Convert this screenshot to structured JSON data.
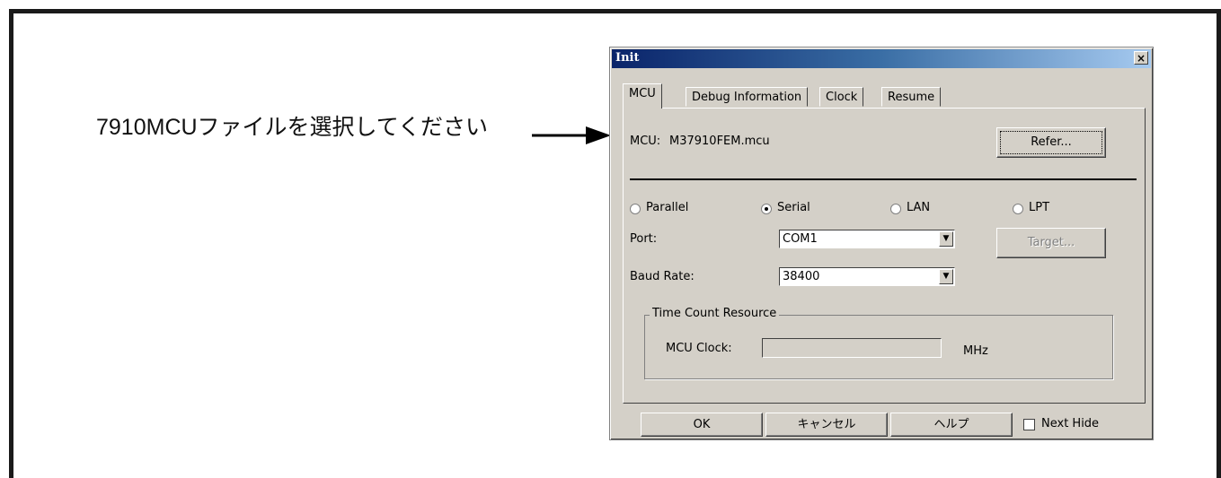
{
  "annotation": {
    "text": "7910MCUファイルを選択してください"
  },
  "dialog": {
    "title": "Init",
    "close_glyph": "×",
    "tabs": [
      {
        "label": "MCU",
        "active": true
      },
      {
        "label": "Debug Information",
        "active": false
      },
      {
        "label": "Clock",
        "active": false
      },
      {
        "label": "Resume",
        "active": false
      }
    ],
    "mcu": {
      "label": "MCU:",
      "value": "M37910FEM.mcu",
      "refer_label": "Refer..."
    },
    "connection": {
      "options": [
        {
          "label": "Parallel",
          "checked": false
        },
        {
          "label": "Serial",
          "checked": true
        },
        {
          "label": "LAN",
          "checked": false
        },
        {
          "label": "LPT",
          "checked": false
        }
      ],
      "target_label": "Target..."
    },
    "port": {
      "label": "Port:",
      "value": "COM1"
    },
    "baud": {
      "label": "Baud Rate:",
      "value": "38400"
    },
    "time_count": {
      "legend": "Time Count Resource",
      "clock_label": "MCU Clock:",
      "clock_value": "",
      "unit": "MHz"
    },
    "footer": {
      "ok_label": "OK",
      "cancel_label": "キャンセル",
      "help_label": "ヘルプ",
      "next_hide_label": "Next Hide",
      "next_hide_checked": false
    }
  },
  "colors": {
    "titlebar_start": "#0a246a",
    "titlebar_end": "#a6caf0",
    "dialog_bg": "#d4d0c8"
  }
}
